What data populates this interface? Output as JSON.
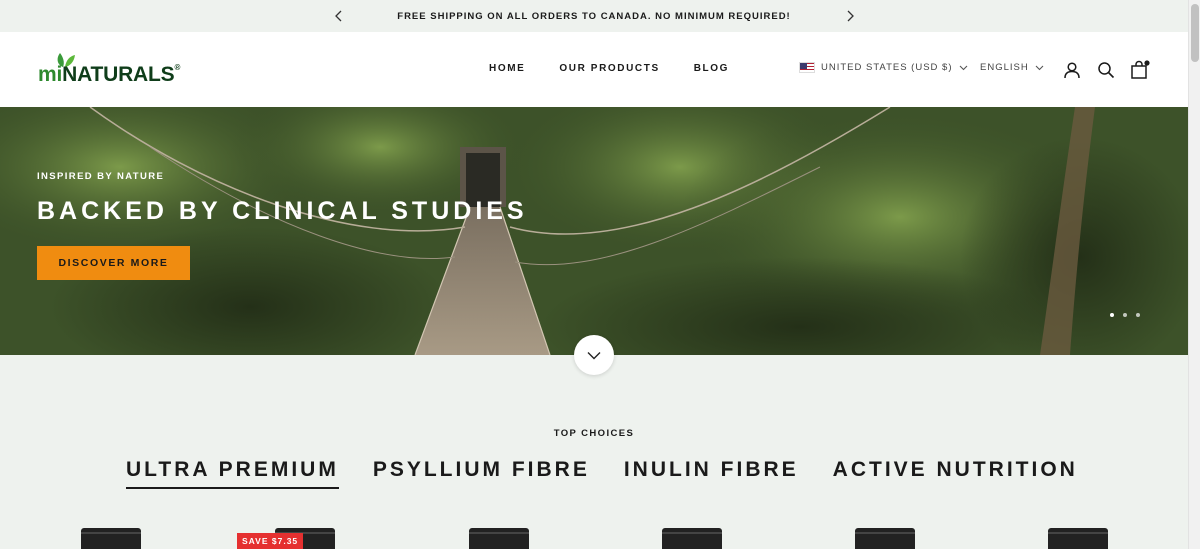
{
  "announcement": {
    "text": "FREE SHIPPING ON ALL ORDERS TO CANADA. NO MINIMUM REQUIRED!"
  },
  "header": {
    "logo": {
      "mi": "mi",
      "rest": "NATURALS",
      "registered": "®"
    },
    "nav": [
      {
        "label": "HOME"
      },
      {
        "label": "OUR PRODUCTS"
      },
      {
        "label": "BLOG"
      }
    ],
    "country": {
      "label": "UNITED STATES (USD $)",
      "flag": "us-flag-icon"
    },
    "language": {
      "label": "ENGLISH"
    },
    "icons": [
      "account-icon",
      "search-icon",
      "cart-icon"
    ]
  },
  "hero": {
    "kicker": "INSPIRED BY NATURE",
    "title": "BACKED BY CLINICAL STUDIES",
    "cta": "DISCOVER MORE",
    "slide_count": 3,
    "active_slide": 1
  },
  "top_choices": {
    "label": "TOP CHOICES",
    "tabs": [
      {
        "label": "ULTRA PREMIUM",
        "active": true
      },
      {
        "label": "PSYLLIUM FIBRE",
        "active": false
      },
      {
        "label": "INULIN FIBRE",
        "active": false
      },
      {
        "label": "ACTIVE NUTRITION",
        "active": false
      }
    ],
    "badge": "SAVE $7.35"
  },
  "colors": {
    "accent": "#f08c10",
    "brand_green": "#2e8a2e",
    "brand_dark_green": "#0f3d1a",
    "sale_red": "#e53030",
    "page_bg": "#eef2ee"
  }
}
